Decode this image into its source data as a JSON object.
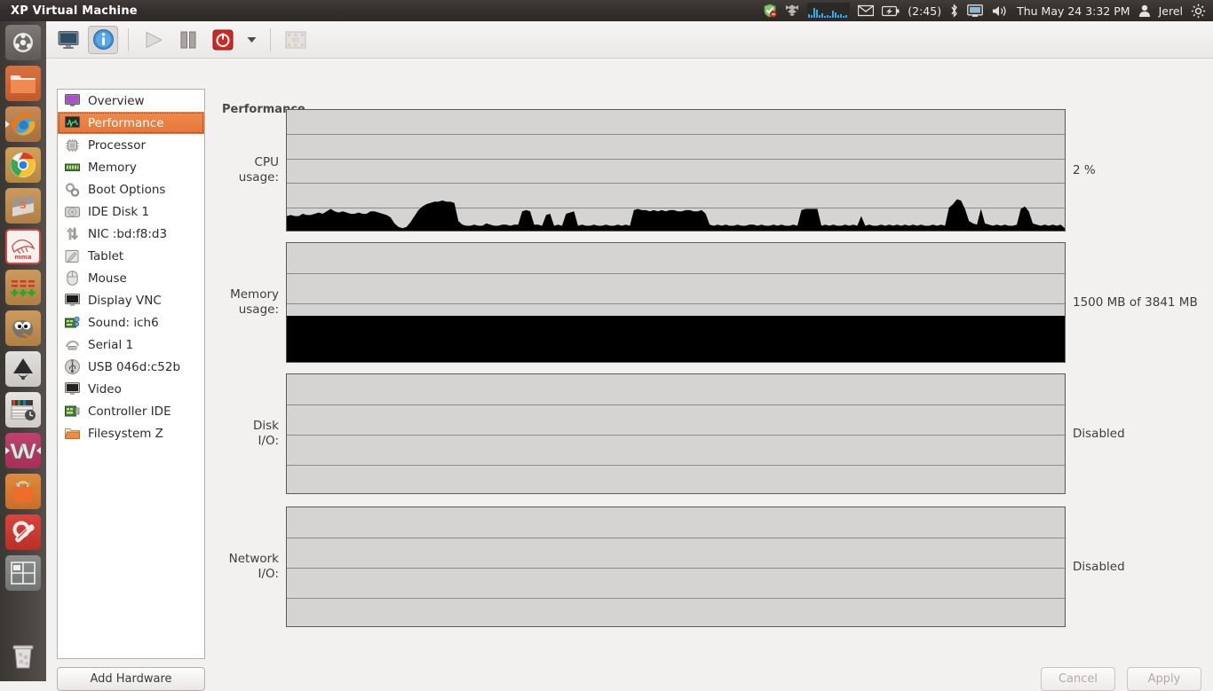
{
  "panel": {
    "title": "XP Virtual Machine",
    "tray": {
      "update_icon": "update-shield-icon",
      "dropbox_icon": "dropbox-icon",
      "sysmonitor_icon": "system-monitor-graph-icon",
      "mail_icon": "mail-envelope-icon",
      "battery_icon": "battery-charging-icon",
      "battery_time": "(2:45)",
      "bluetooth_icon": "bluetooth-icon",
      "display_icon": "display-icon",
      "volume_icon": "volume-icon",
      "datetime": "Thu May 24  3:32 PM",
      "user_icon": "user-icon",
      "user_name": "Jerel",
      "settings_icon": "gear-icon"
    }
  },
  "launcher": {
    "items": [
      {
        "name": "ubuntu-dash",
        "icon": "ubuntu-logo-icon",
        "running": false
      },
      {
        "name": "files",
        "icon": "folder-icon",
        "running": false
      },
      {
        "name": "firefox",
        "icon": "firefox-icon",
        "running": true
      },
      {
        "name": "chrome",
        "icon": "chrome-icon",
        "running": false
      },
      {
        "name": "sublime-text",
        "icon": "sublime-s-icon",
        "running": false
      },
      {
        "name": "mysql-workbench",
        "icon": "dolphin-icon",
        "running": false
      },
      {
        "name": "pgadmin",
        "icon": "plus-rows-icon",
        "running": false
      },
      {
        "name": "gimp",
        "icon": "gimp-wilber-icon",
        "running": false
      },
      {
        "name": "inkscape",
        "icon": "inkscape-icon",
        "running": false
      },
      {
        "name": "openshot",
        "icon": "clapperboard-icon",
        "running": false
      },
      {
        "name": "virtual-machine-manager",
        "icon": "vmm-icon",
        "running": true
      },
      {
        "name": "software-center",
        "icon": "software-bag-icon",
        "running": false
      },
      {
        "name": "system-settings",
        "icon": "gear-wrench-icon",
        "running": false
      },
      {
        "name": "workspace-switcher",
        "icon": "workspace-icon",
        "running": false
      },
      {
        "name": "trash",
        "icon": "trash-icon",
        "running": false
      }
    ]
  },
  "toolbar": {
    "console_label": "Show the graphical console",
    "details_label": "Show virtual hardware details",
    "run_label": "Run",
    "pause_label": "Pause",
    "shutdown_label": "Shut down",
    "shutdown_menu_label": "Shut down options",
    "snapshot_label": "Manage snapshots"
  },
  "hardware": {
    "items": [
      {
        "label": "Overview",
        "icon": "monitor-purple-icon"
      },
      {
        "label": "Performance",
        "icon": "performance-wave-icon"
      },
      {
        "label": "Processor",
        "icon": "cpu-chip-icon"
      },
      {
        "label": "Memory",
        "icon": "memory-stick-icon"
      },
      {
        "label": "Boot Options",
        "icon": "gears-icon"
      },
      {
        "label": "IDE Disk 1",
        "icon": "hard-disk-icon"
      },
      {
        "label": "NIC :bd:f8:d3",
        "icon": "network-arrows-icon"
      },
      {
        "label": "Tablet",
        "icon": "tablet-pen-icon"
      },
      {
        "label": "Mouse",
        "icon": "mouse-icon"
      },
      {
        "label": "Display VNC",
        "icon": "display-icon"
      },
      {
        "label": "Sound: ich6",
        "icon": "sound-card-icon"
      },
      {
        "label": "Serial 1",
        "icon": "serial-port-icon"
      },
      {
        "label": "USB 046d:c52b",
        "icon": "usb-icon"
      },
      {
        "label": "Video",
        "icon": "video-icon"
      },
      {
        "label": "Controller IDE",
        "icon": "controller-card-icon"
      },
      {
        "label": "Filesystem Z",
        "icon": "folder-orange-icon"
      }
    ],
    "selected_index": 1,
    "add_hardware_label": "Add Hardware"
  },
  "performance": {
    "title": "Performance",
    "graphs": [
      {
        "label": "CPU\nusage:",
        "name": "cpu-usage",
        "value": "2 %"
      },
      {
        "label": "Memory\nusage:",
        "name": "memory-usage",
        "value": "1500 MB of 3841 MB"
      },
      {
        "label": "Disk\nI/O:",
        "name": "disk-io",
        "value": "Disabled"
      },
      {
        "label": "Network\nI/O:",
        "name": "network-io",
        "value": "Disabled"
      }
    ]
  },
  "chart_data": [
    {
      "type": "area",
      "name": "cpu-usage",
      "title": "CPU usage:",
      "ylabel": "percent",
      "ylim": [
        0,
        100
      ],
      "gridlines": 4,
      "current_value": "2 %",
      "values": [
        12,
        13,
        12,
        12,
        14,
        13,
        13,
        14,
        15,
        14,
        16,
        18,
        16,
        15,
        16,
        15,
        14,
        14,
        15,
        14,
        14,
        16,
        16,
        15,
        14,
        13,
        11,
        6,
        3,
        2,
        3,
        7,
        12,
        17,
        20,
        22,
        23,
        24,
        24,
        25,
        24,
        24,
        23,
        8,
        5,
        4,
        4,
        5,
        4,
        4,
        6,
        5,
        4,
        4,
        5,
        5,
        4,
        5,
        5,
        16,
        17,
        16,
        5,
        5,
        4,
        13,
        14,
        4,
        5,
        4,
        14,
        15,
        16,
        4,
        5,
        4,
        4,
        5,
        4,
        4,
        5,
        4,
        4,
        5,
        4,
        5,
        4,
        17,
        18,
        17,
        17,
        16,
        17,
        16,
        17,
        16,
        17,
        17,
        16,
        16,
        17,
        17,
        16,
        16,
        17,
        14,
        5,
        4,
        5,
        4,
        5,
        4,
        4,
        5,
        4,
        4,
        5,
        5,
        4,
        5,
        4,
        4,
        5,
        4,
        5,
        4,
        4,
        5,
        4,
        17,
        18,
        18,
        18,
        18,
        4,
        5,
        4,
        5,
        4,
        4,
        5,
        4,
        5,
        4,
        12,
        4,
        5,
        4,
        4,
        5,
        4,
        5,
        4,
        5,
        4,
        5,
        4,
        5,
        4,
        5,
        4,
        4,
        5,
        4,
        5,
        4,
        19,
        22,
        26,
        25,
        18,
        8,
        6,
        5,
        18,
        6,
        5,
        4,
        5,
        4,
        5,
        4,
        4,
        5,
        18,
        20,
        16,
        6,
        5,
        4,
        5,
        4,
        5,
        4,
        5,
        2
      ]
    },
    {
      "type": "area",
      "name": "memory-usage",
      "title": "Memory usage:",
      "ylabel": "MB",
      "ylim": [
        0,
        3841
      ],
      "gridlines": 3,
      "current_value": "1500 MB of 3841 MB",
      "fill_fraction": 0.39,
      "used_mb": 1500,
      "total_mb": 3841
    },
    {
      "type": "area",
      "name": "disk-io",
      "title": "Disk I/O:",
      "ylim": [
        0,
        100
      ],
      "gridlines": 3,
      "current_value": "Disabled",
      "values": []
    },
    {
      "type": "area",
      "name": "network-io",
      "title": "Network I/O:",
      "ylim": [
        0,
        100
      ],
      "gridlines": 3,
      "current_value": "Disabled",
      "values": []
    }
  ],
  "footer": {
    "cancel_label": "Cancel",
    "apply_label": "Apply"
  },
  "colors": {
    "accent_selected": "#e8753a",
    "panel_bg": "#332f2c",
    "graph_bg": "#d6d4d2",
    "graph_fill": "#000000",
    "window_bg": "#f2f1f0"
  }
}
